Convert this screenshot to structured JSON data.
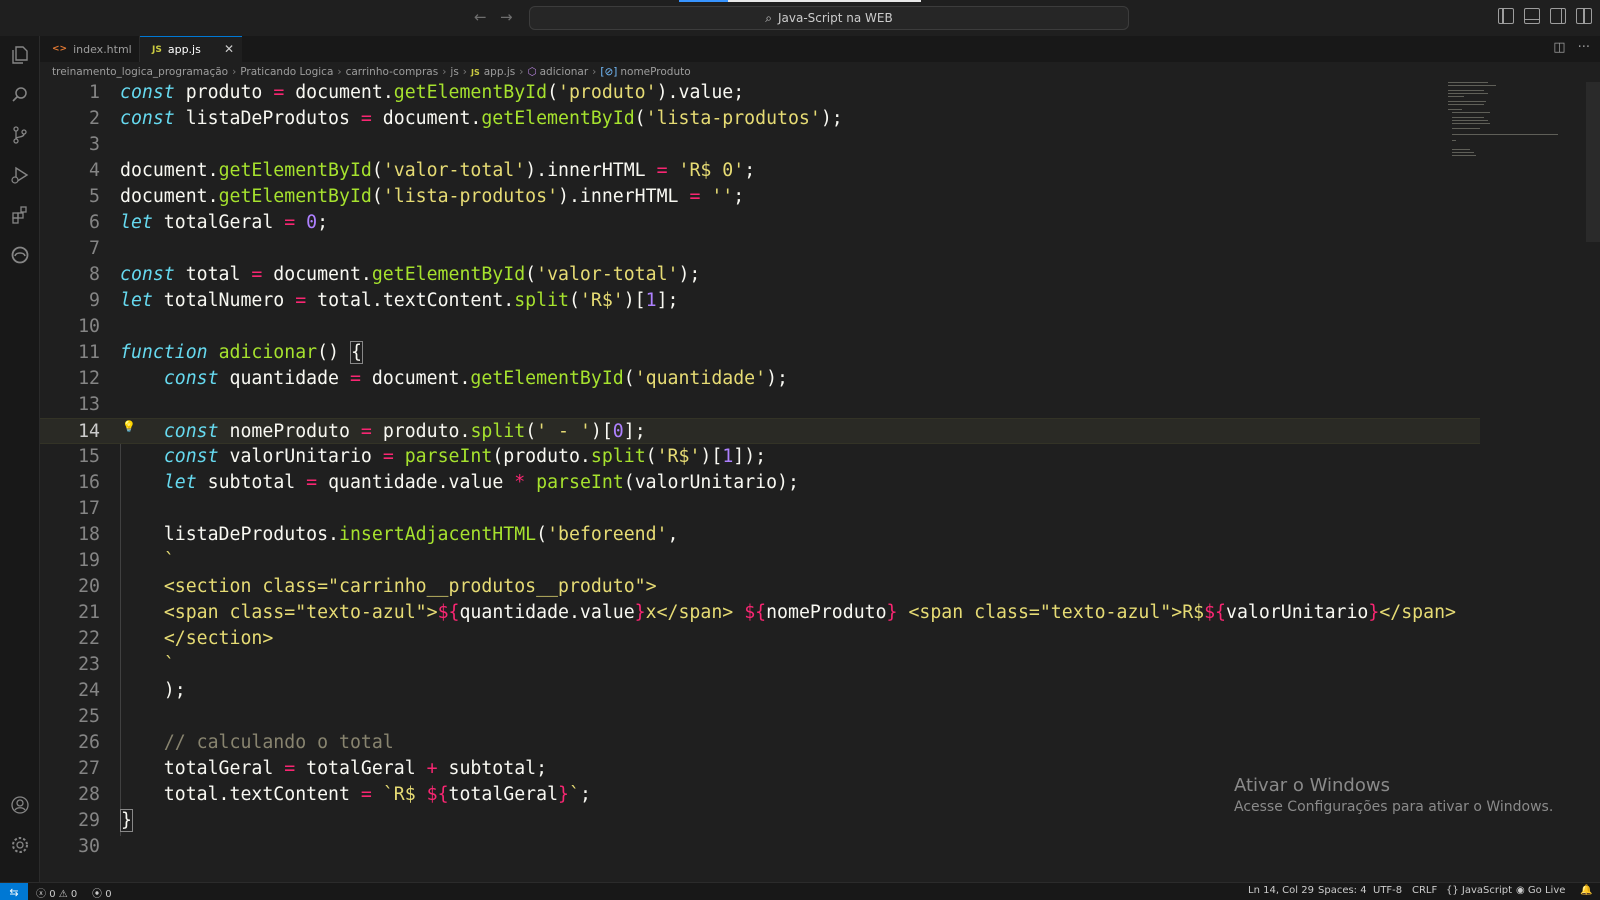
{
  "titlebar": {
    "search_label": "Java-Script na WEB",
    "back_icon": "arrow-left-icon",
    "forward_icon": "arrow-right-icon"
  },
  "activity_bar": [
    "explorer-icon",
    "search-icon",
    "source-control-icon",
    "run-debug-icon",
    "extensions-icon",
    "edge-devtools-icon",
    "account-icon",
    "settings-gear-icon"
  ],
  "tabs": [
    {
      "label": "index.html",
      "icon": "html",
      "active": false
    },
    {
      "label": "app.js",
      "icon": "js",
      "active": true
    }
  ],
  "breadcrumb": {
    "items": [
      "treinamento_logica_programação",
      "Praticando Logica",
      "carrinho-compras",
      "js"
    ],
    "file": "app.js",
    "function": "adicionar",
    "variable": "nomeProduto"
  },
  "editor": {
    "current_line": 14,
    "line_numbers": [
      "1",
      "2",
      "3",
      "4",
      "5",
      "6",
      "7",
      "8",
      "9",
      "10",
      "11",
      "12",
      "13",
      "14",
      "15",
      "16",
      "17",
      "18",
      "19",
      "20",
      "21",
      "22",
      "23",
      "24",
      "25",
      "26",
      "27",
      "28",
      "29",
      "30"
    ]
  },
  "watermark": {
    "title": "Ativar o Windows",
    "subtitle": "Acesse Configurações para ativar o Windows."
  },
  "statusbar": {
    "errors": "0",
    "warnings": "0",
    "ports": "0",
    "cursor": "Ln 14, Col 29",
    "spaces": "Spaces: 4",
    "encoding": "UTF-8",
    "eol": "CRLF",
    "language": "JavaScript",
    "golive": "Go Live"
  },
  "colors": {
    "accent": "#0078d4",
    "editor_bg": "#1f1f1f",
    "keyword": "#66d9ef",
    "function": "#a6e22e",
    "string": "#e6db74",
    "operator": "#f92672",
    "number": "#ae81ff"
  }
}
